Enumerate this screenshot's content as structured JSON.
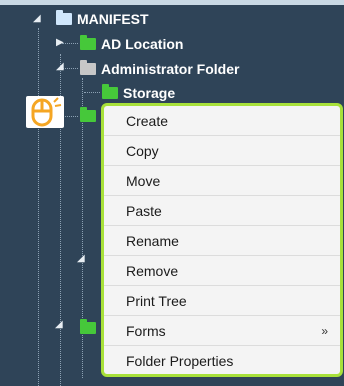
{
  "tree": {
    "root": {
      "label": "MANIFEST",
      "icon": "folder-open-icon"
    },
    "children": [
      {
        "label": "AD Location",
        "icon": "folder-icon",
        "color": "#46c83a"
      },
      {
        "label": "Administrator Folder",
        "icon": "folder-icon",
        "color": "#c7c7c7"
      },
      {
        "label": "Storage",
        "icon": "folder-icon",
        "color": "#46c83a"
      }
    ]
  },
  "context_menu": {
    "items": [
      {
        "label": "Create"
      },
      {
        "label": "Copy"
      },
      {
        "label": "Move"
      },
      {
        "label": "Paste"
      },
      {
        "label": "Rename"
      },
      {
        "label": "Remove"
      },
      {
        "label": "Print Tree"
      },
      {
        "label": "Forms",
        "submenu_indicator": "»"
      },
      {
        "label": "Folder Properties"
      }
    ],
    "highlight_color": "#a8e13a"
  },
  "colors": {
    "tree_background": "#2f4458",
    "mouse_icon": "#f5a623"
  }
}
